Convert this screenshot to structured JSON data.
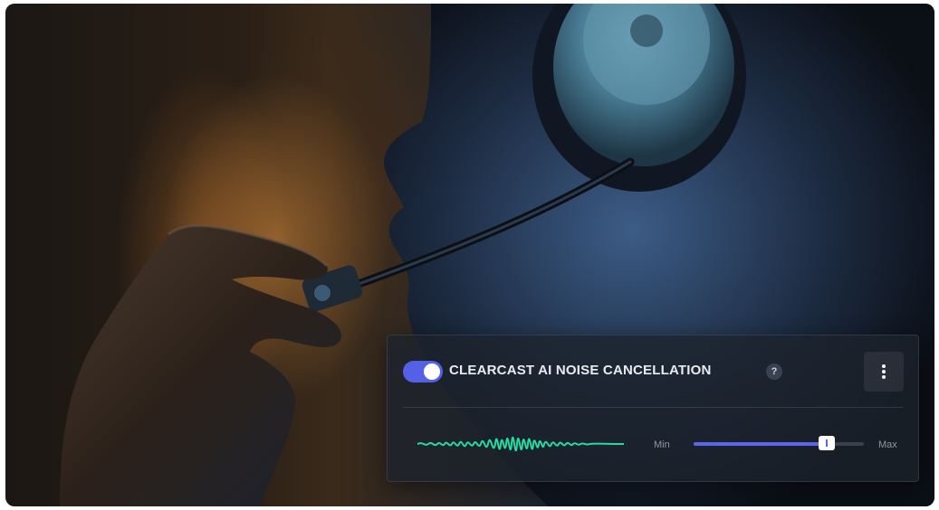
{
  "panel": {
    "toggle_on": true,
    "title": "CLEARCAST AI NOISE CANCELLATION",
    "help_label": "?",
    "menu_icon": "vertical-ellipsis-icon",
    "waveform_icon": "audio-waveform-icon",
    "slider": {
      "min_label": "Min",
      "max_label": "Max",
      "value_fraction": 0.78
    }
  },
  "colors": {
    "accent": "#5a66ef",
    "waveform": "#27d9a0",
    "panel_bg": "#1c222c"
  }
}
